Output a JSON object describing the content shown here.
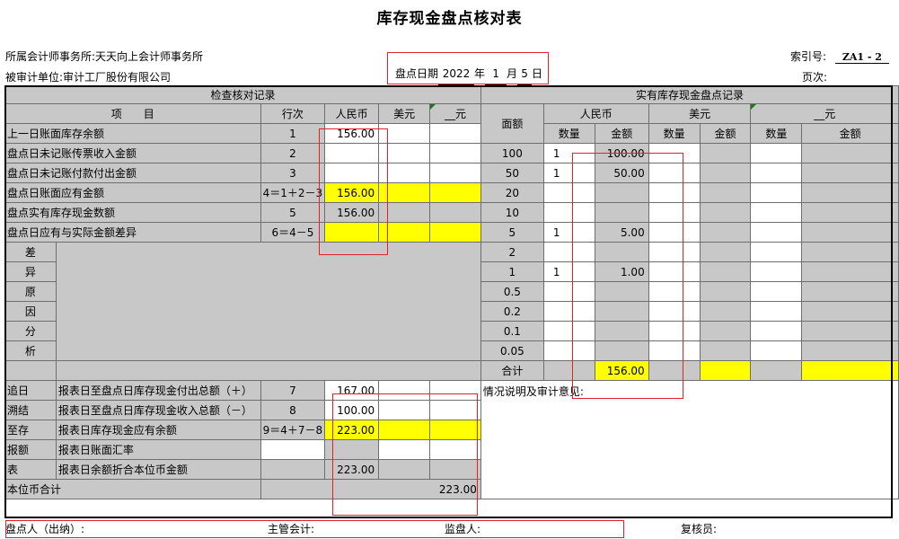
{
  "title": "库存现金盘点核对表",
  "header": {
    "firm_label": "所属会计师事务所:",
    "firm": "天天向上会计师事务所",
    "entity_label": "被审计单位:",
    "entity": "审计工厂股份有限公司",
    "date_label": "盘点日期",
    "date_year": "2022",
    "date_month": "1",
    "date_day": "5",
    "year_unit": "年",
    "month_unit": "月",
    "day_unit": "日",
    "index_label": "索引号:",
    "index_value": "ZA1 - 2",
    "page_label": "页次:"
  },
  "check": {
    "section_title": "检查核对记录",
    "col_item": "项　　目",
    "col_line": "行次",
    "col_rmb": "人民币",
    "col_usd": "美元",
    "col_other": "__元",
    "rows": [
      {
        "item": "上一日账面库存余额",
        "line": "1",
        "rmb": "156.00"
      },
      {
        "item": "盘点日未记账传票收入金额",
        "line": "2",
        "rmb": ""
      },
      {
        "item": "盘点日未记账付款付出金额",
        "line": "3",
        "rmb": ""
      },
      {
        "item": "盘点日账面应有金额",
        "line": "4＝1＋2－3",
        "rmb": "156.00"
      },
      {
        "item": "盘点实有库存现金数额",
        "line": "5",
        "rmb": "156.00"
      },
      {
        "item": "盘点日应有与实际金额差异",
        "line": "6＝4－5",
        "rmb": ""
      }
    ],
    "diff_reason_chars": [
      "差",
      "异",
      "原",
      "因",
      "分",
      "析"
    ],
    "trace_chars": [
      "追日",
      "溯结",
      "至存",
      "报额",
      "表"
    ],
    "trace_rows": [
      {
        "item": "报表日至盘点日库存现金付出总额（＋）",
        "line": "7",
        "rmb": "167.00"
      },
      {
        "item": "报表日至盘点日库存现金收入总额（－）",
        "line": "8",
        "rmb": "100.00"
      },
      {
        "item": "报表日库存现金应有余额",
        "line": "9＝4＋7－8",
        "rmb": "223.00"
      },
      {
        "item": "报表日账面汇率",
        "line": "",
        "rmb": ""
      },
      {
        "item": "报表日余额折合本位币金额",
        "line": "",
        "rmb": "223.00"
      }
    ],
    "base_total_label": "本位币合计",
    "base_total_value": "223.00"
  },
  "count": {
    "section_title": "实有库存现金盘点记录",
    "col_denom": "面额",
    "col_rmb": "人民币",
    "col_usd": "美元",
    "col_other": "__元",
    "qty_label": "数量",
    "amt_label": "金额",
    "rows": [
      {
        "denom": "100",
        "qty": "1",
        "amt": "100.00"
      },
      {
        "denom": "50",
        "qty": "1",
        "amt": "50.00"
      },
      {
        "denom": "20",
        "qty": "",
        "amt": ""
      },
      {
        "denom": "10",
        "qty": "",
        "amt": ""
      },
      {
        "denom": "5",
        "qty": "1",
        "amt": "5.00"
      },
      {
        "denom": "2",
        "qty": "",
        "amt": ""
      },
      {
        "denom": "1",
        "qty": "1",
        "amt": "1.00"
      },
      {
        "denom": "0.5",
        "qty": "",
        "amt": ""
      },
      {
        "denom": "0.2",
        "qty": "",
        "amt": ""
      },
      {
        "denom": "0.1",
        "qty": "",
        "amt": ""
      },
      {
        "denom": "0.05",
        "qty": "",
        "amt": ""
      }
    ],
    "total_label": "合计",
    "total_amt": "156.00",
    "remarks_label": "情况说明及审计意见:"
  },
  "footer": {
    "counter_label": "盘点人（出纳）:",
    "supervisor_label": "主管会计:",
    "monitor_label": "监盘人:",
    "reviewer_label": "复核员:"
  },
  "colors": {
    "highlight": "#ffff00",
    "cell_gray": "#c8c8c8",
    "annotation_red": "#e0202a"
  }
}
